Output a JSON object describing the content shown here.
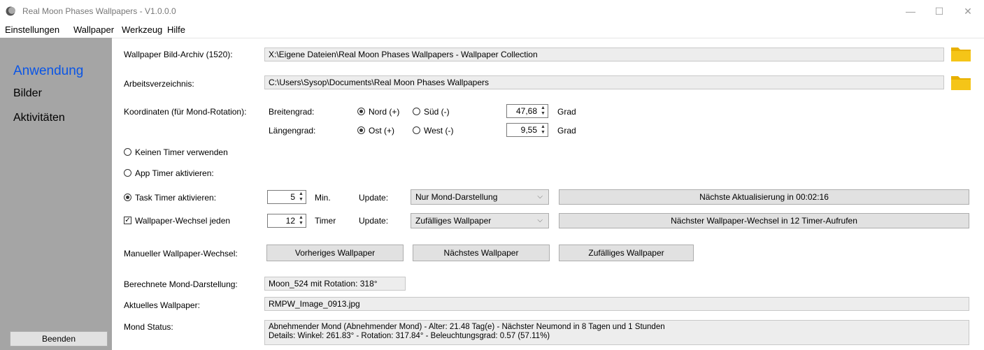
{
  "window": {
    "title": "Real Moon Phases Wallpapers - V1.0.0.0",
    "minimize": "—",
    "maximize": "☐",
    "close": "✕"
  },
  "menu": {
    "items": [
      "Einstellungen",
      "Wallpaper",
      "Werkzeug",
      "Hilfe"
    ]
  },
  "sidebar": {
    "items": [
      "Anwendung",
      "Bilder",
      "Aktivitäten"
    ],
    "quit": "Beenden"
  },
  "archive": {
    "label": "Wallpaper Bild-Archiv (1520):",
    "value": "X:\\Eigene Dateien\\Real Moon Phases Wallpapers - Wallpaper Collection"
  },
  "workdir": {
    "label": "Arbeitsverzeichnis:",
    "value": "C:\\Users\\Sysop\\Documents\\Real Moon Phases Wallpapers"
  },
  "coords": {
    "label": "Koordinaten (für Mond-Rotation):",
    "lat": {
      "label": "Breitengrad:",
      "opt1": "Nord (+)",
      "opt2": "Süd (-)",
      "value": "47,68",
      "unit": "Grad"
    },
    "lon": {
      "label": "Längengrad:",
      "opt1": "Ost (+)",
      "opt2": "West (-)",
      "value": "9,55",
      "unit": "Grad"
    }
  },
  "timer": {
    "none": "Keinen Timer verwenden",
    "app": "App Timer aktivieren:",
    "task": "Task Timer aktivieren:",
    "task_value": "5",
    "task_unit": "Min.",
    "update_label": "Update:",
    "task_update": "Nur Mond-Darstellung",
    "task_status": "Nächste Aktualisierung in 00:02:16",
    "wp_change": "Wallpaper-Wechsel jeden",
    "wp_value": "12",
    "wp_unit": "Timer",
    "wp_update": "Zufälliges Wallpaper",
    "wp_status": "Nächster Wallpaper-Wechsel in 12 Timer-Aufrufen"
  },
  "manual": {
    "label": "Manueller Wallpaper-Wechsel:",
    "prev": "Vorheriges Wallpaper",
    "next": "Nächstes Wallpaper",
    "random": "Zufälliges Wallpaper"
  },
  "calc": {
    "label": "Berechnete Mond-Darstellung:",
    "value": "Moon_524 mit Rotation: 318°"
  },
  "current": {
    "label": "Aktuelles Wallpaper:",
    "value": "RMPW_Image_0913.jpg"
  },
  "status": {
    "label": "Mond Status:",
    "line1": "Abnehmender Mond (Abnehmender Mond) - Alter: 21.48 Tag(e) - Nächster Neumond in 8 Tagen und 1 Stunden",
    "line2": "Details: Winkel: 261.83° - Rotation: 317.84° - Beleuchtungsgrad: 0.57 (57.11%)"
  },
  "colors": {
    "sidebar": "#a5a5a5",
    "active_nav": "#0a55e6",
    "folder": "#f5c518"
  }
}
